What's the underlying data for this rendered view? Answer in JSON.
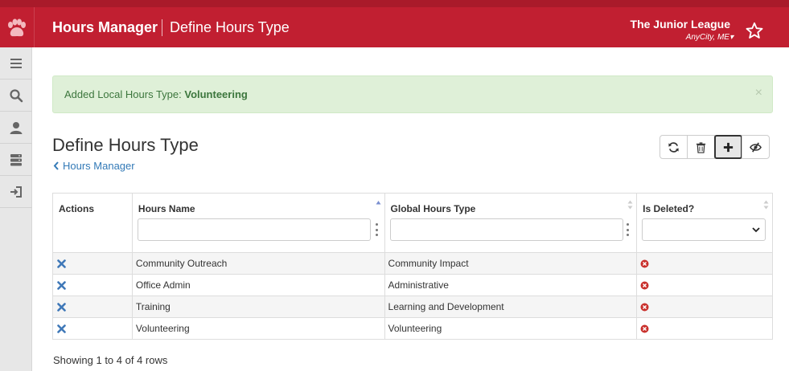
{
  "header": {
    "app_title": "Hours Manager",
    "page_subtitle": "Define Hours Type",
    "org_name": "The Junior League",
    "org_location": "AnyCity, ME"
  },
  "sidebar": {
    "items": [
      {
        "icon": "menu-icon"
      },
      {
        "icon": "search-icon"
      },
      {
        "icon": "user-icon"
      },
      {
        "icon": "server-icon"
      },
      {
        "icon": "sign-in-icon"
      }
    ]
  },
  "alert": {
    "prefix": "Added Local Hours Type: ",
    "name": "Volunteering",
    "close": "×"
  },
  "page": {
    "heading": "Define Hours Type",
    "breadcrumb": "Hours Manager"
  },
  "table": {
    "columns": {
      "actions": "Actions",
      "hours_name": "Hours Name",
      "global_hours_type": "Global Hours Type",
      "is_deleted": "Is Deleted?"
    },
    "rows": [
      {
        "hours_name": "Community Outreach",
        "global_hours_type": "Community Impact"
      },
      {
        "hours_name": "Office Admin",
        "global_hours_type": "Administrative"
      },
      {
        "hours_name": "Training",
        "global_hours_type": "Learning and Development"
      },
      {
        "hours_name": "Volunteering",
        "global_hours_type": "Volunteering"
      }
    ]
  },
  "pagination": {
    "summary": "Showing 1 to 4 of 4 rows"
  },
  "colors": {
    "brand_red": "#c11f31",
    "link_blue": "#337ab7",
    "alert_green_bg": "#dff0d8",
    "alert_green_text": "#3c763d",
    "deleted_red": "#c9302c"
  }
}
